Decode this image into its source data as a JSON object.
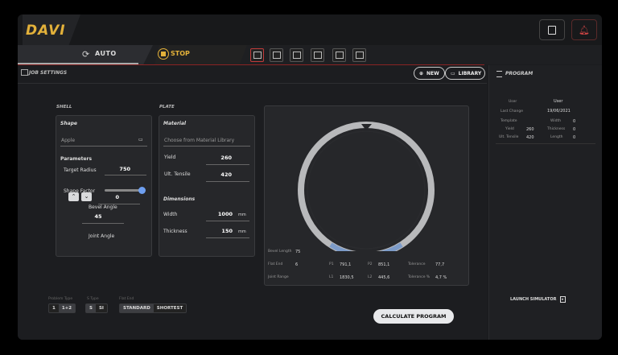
{
  "app": {
    "logo": "DAVI",
    "note_icon": "note-icon",
    "bell_icon": "bell-icon"
  },
  "modes": {
    "auto": "AUTO",
    "stop": "STOP"
  },
  "header": {
    "title": "JOB SETTINGS",
    "new_btn": "NEW",
    "library_btn": "LIBRARY"
  },
  "shell": {
    "section": "SHELL",
    "shape_title": "Shape",
    "shape_value": "Apple",
    "parameters": "Parameters",
    "target_radius_label": "Target Radius",
    "target_radius": "750",
    "shape_factor_label": "Shape Factor",
    "shape_factor_level": 0.92,
    "bevel_label": "Bevel Angle",
    "bevel_value": "45",
    "joint_label": "Joint Angle",
    "joint_value": "0"
  },
  "plate": {
    "section": "PLATE",
    "material_title": "Material",
    "material_placeholder": "Choose from Material Library",
    "yield_label": "Yield",
    "yield_value": "260",
    "ult_label": "Ult. Tensile",
    "ult_value": "420",
    "dimensions": "Dimensions",
    "width_label": "Width",
    "width_value": "1000",
    "width_unit": "mm",
    "thickness_label": "Thickness",
    "thickness_value": "150",
    "thickness_unit": "mm"
  },
  "preview": {
    "bevel_length_label": "Bevel Length",
    "bevel_length": "75",
    "flat_end_label": "Flat End",
    "flat_end": "6",
    "p1_label": "P1",
    "p1": "791,1",
    "p2_label": "P2",
    "p2": "851,1",
    "tolerance_label": "Tolerance",
    "tolerance": "77,7",
    "joint_range_label": "Joint Range",
    "l1_label": "L1",
    "l1": "1830,5",
    "l2_label": "L2",
    "l2": "445,6",
    "tolerance_pct_label": "Tolerance %",
    "tolerance_pct": "4,7 %"
  },
  "bottom": {
    "problem_type": "Problem Type",
    "s_type": "S Type",
    "flat_end": "Flat End",
    "seg1": [
      "1",
      "1+2"
    ],
    "seg2": [
      "S",
      "SI"
    ],
    "seg3": [
      "STANDARD",
      "SHORTEST"
    ],
    "calculate": "CALCULATE PROGRAM"
  },
  "program": {
    "title": "PROGRAM",
    "user_label": "User",
    "user": "User",
    "last_change_label": "Last Change",
    "last_change": "19/06/2021",
    "template_label": "Template",
    "width_label": "Width",
    "width": "0",
    "yield_label": "Yield",
    "yield": "260",
    "thickness_label": "Thickness",
    "thickness": "0",
    "ult_label": "Ult. Tensile",
    "ult": "420",
    "length_label": "Length",
    "length": "0",
    "launch": "LAUNCH SIMULATOR"
  },
  "colors": {
    "accent": "#e3b13a",
    "danger": "#c23b3b",
    "slider": "#6e9ff0"
  }
}
